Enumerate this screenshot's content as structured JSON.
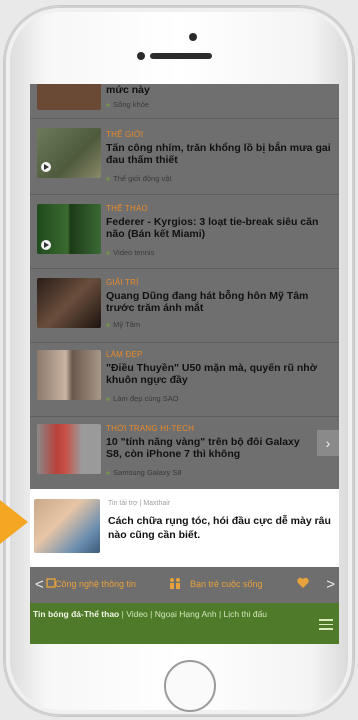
{
  "feed": {
    "items": [
      {
        "category": "",
        "title": "mức này",
        "tag": "Sống khỏe",
        "thumb_color": "#7a5a3c"
      },
      {
        "category": "THẾ GIỚI",
        "title": "Tấn công nhím, trăn khổng lồ bị bắn mưa gai đau thấm thiết",
        "tag": "Thế giới động vật",
        "thumb_color": "#6b7a5a"
      },
      {
        "category": "THỂ THAO",
        "title": "Federer - Kyrgios: 3 loạt tie-break siêu căn não (Bán kết Miami)",
        "tag": "Video tennis",
        "thumb_color": "#2f5a2a"
      },
      {
        "category": "GIẢI TRÍ",
        "title": "Quang Dũng đang hát bỗng hôn Mỹ Tâm trước trăm ánh mắt",
        "tag": "Mỹ Tâm",
        "thumb_color": "#4a3a30"
      },
      {
        "category": "LÀM ĐẸP",
        "title": "\"Điều Thuyền\" U50 mặn mà, quyến rũ nhờ khuôn ngực đầy",
        "tag": "Làm đẹp cùng SAO",
        "thumb_color": "#8a7a70"
      },
      {
        "category": "THỜI TRANG HI-TECH",
        "title": "10 \"tính năng vàng\" trên bộ đôi Galaxy S8, còn iPhone 7 thì không",
        "tag": "Samsung Galaxy S8",
        "thumb_color": "#b8423c"
      }
    ],
    "next_arrow": "›"
  },
  "ad": {
    "source": "Tin tài trợ | Maxthair",
    "title": "Cách chữa rụng tóc, hói đầu cực dễ mày râu nào cũng cần biết."
  },
  "catbar": {
    "prev": "<",
    "next": ">",
    "items": [
      "Công nghệ thông tin",
      "Bạn trẻ cuộc sống"
    ]
  },
  "bottombar": {
    "links_bold": "Tin bóng đá-Thể thao",
    "links_rest": "Video | Ngoại Hạng Anh | Lịch thi đấu"
  },
  "colors": {
    "accent": "#e88a2a",
    "bar": "#4e7a2a",
    "pointer": "#f5a623"
  }
}
